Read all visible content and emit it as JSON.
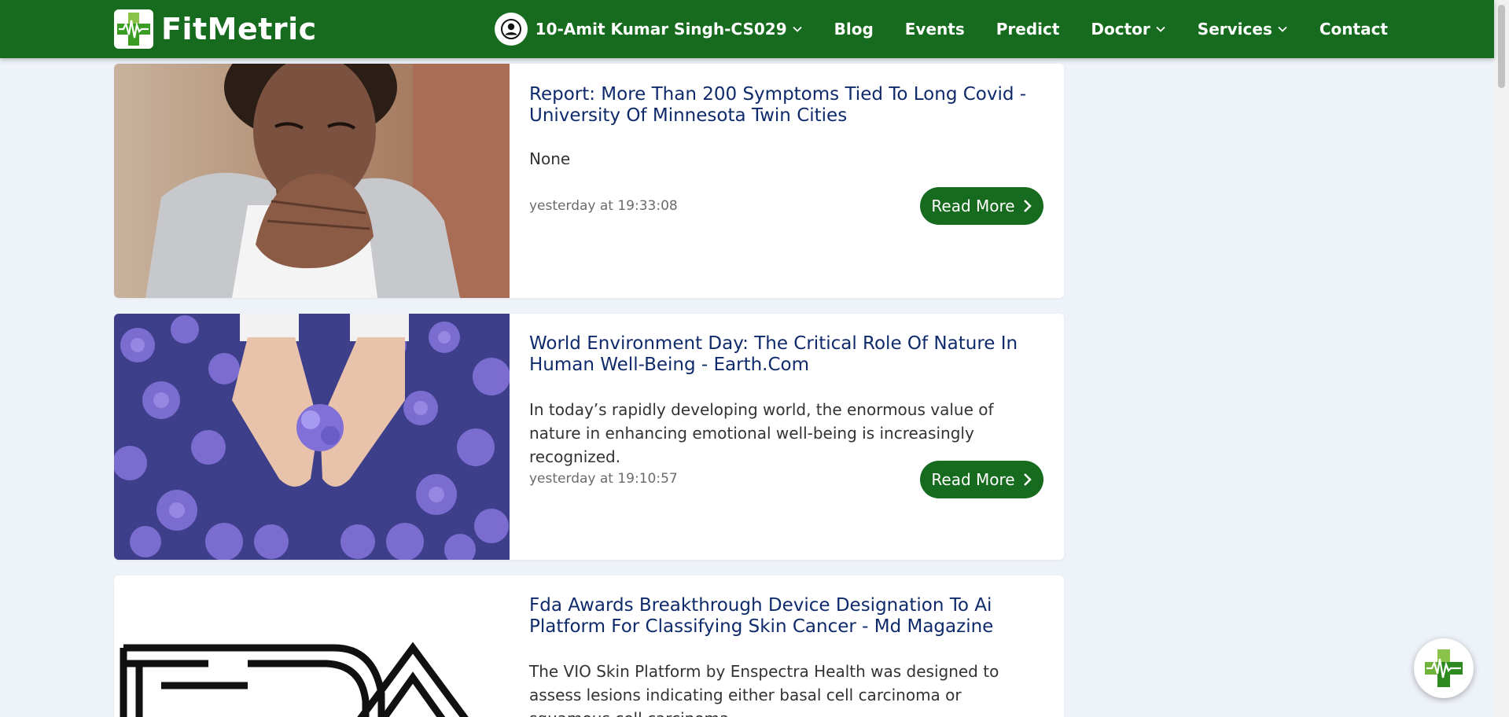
{
  "navbar": {
    "brand_name": "FitMetric",
    "user_name": "10-Amit Kumar Singh-CS029",
    "items": [
      {
        "label": "Blog"
      },
      {
        "label": "Events"
      },
      {
        "label": "Predict"
      },
      {
        "label": "Doctor"
      },
      {
        "label": "Services"
      },
      {
        "label": "Contact"
      }
    ]
  },
  "articles": [
    {
      "title": "Report: More Than 200 Symptoms Tied To Long Covid - University Of Minnesota Twin Cities",
      "description": "None",
      "timestamp": "yesterday at 19:33:08",
      "button": "Read More"
    },
    {
      "title": "World Environment Day: The Critical Role Of Nature In Human Well-Being - Earth.Com",
      "description": "In today’s rapidly developing world, the enormous value of nature in enhancing emotional well-being is increasingly recognized.",
      "timestamp": "yesterday at 19:10:57",
      "button": "Read More"
    },
    {
      "title": "Fda Awards Breakthrough Device Designation To Ai Platform For Classifying Skin Cancer - Md Magazine",
      "description": "The VIO Skin Platform by Enspectra Health was designed to assess lesions indicating either basal cell carcinoma or squamous cell carcinoma."
    }
  ],
  "colors": {
    "primary_green": "#176b1e",
    "title_blue": "#0f2a6b",
    "page_bg": "#eef2f9"
  },
  "icons": {
    "brand": "medical-cross-pulse-icon",
    "avatar": "user-circle-icon",
    "dropdown": "chevron-down-icon",
    "read_more": "chevron-right-icon"
  }
}
